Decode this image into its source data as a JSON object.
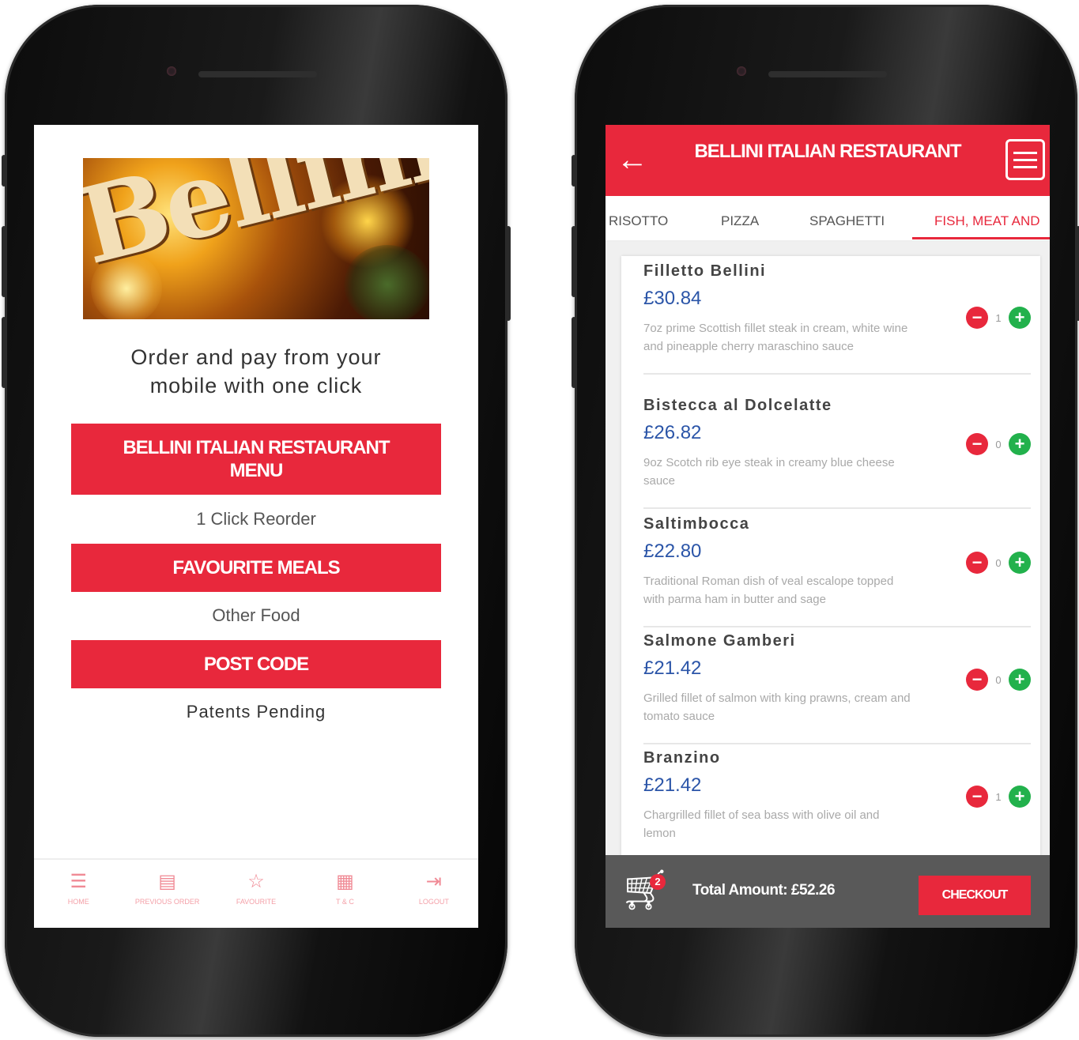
{
  "left": {
    "banner_logo": "Bellini",
    "tagline_line1": "Order and pay from your",
    "tagline_line2": "mobile with one click",
    "menu_button": "BELLINI ITALIAN RESTAURANT MENU",
    "reorder_text": "1 Click Reorder",
    "favourite_button": "FAVOURITE MEALS",
    "other_food_text": "Other Food",
    "postcode_button": "POST CODE",
    "patents_text": "Patents Pending",
    "nav": [
      {
        "icon": "list-icon",
        "label": "HOME"
      },
      {
        "icon": "receipt-icon",
        "label": "PREVIOUS ORDER"
      },
      {
        "icon": "star-icon",
        "label": "FAVOURITE"
      },
      {
        "icon": "calendar-icon",
        "label": "T & C"
      },
      {
        "icon": "logout-icon",
        "label": "LOGOUT"
      }
    ]
  },
  "right": {
    "title": "BELLINI ITALIAN RESTAURANT",
    "tabs": [
      "RISOTTO",
      "PIZZA",
      "SPAGHETTI",
      "FISH, MEAT AND"
    ],
    "active_tab": "FISH, MEAT AND",
    "items": [
      {
        "name": "Filletto Bellini",
        "price": "£30.84",
        "description": "7oz prime Scottish fillet steak in cream, white wine and pineapple cherry maraschino sauce",
        "qty": "1"
      },
      {
        "name": "Bistecca al Dolcelatte",
        "price": "£26.82",
        "description": "9oz Scotch rib eye steak in creamy blue cheese sauce",
        "qty": "0"
      },
      {
        "name": "Saltimbocca",
        "price": "£22.80",
        "description": "Traditional Roman dish of veal escalope topped with parma ham in butter and sage",
        "qty": "0"
      },
      {
        "name": "Salmone Gamberi",
        "price": "£21.42",
        "description": "Grilled fillet of salmon with king prawns, cream and tomato sauce",
        "qty": "0"
      },
      {
        "name": "Branzino",
        "price": "£21.42",
        "description": "Chargrilled fillet of sea bass with olive oil and lemon",
        "qty": "1"
      }
    ],
    "cart_count": "2",
    "total": "Total Amount: £52.26",
    "checkout": "CHECKOUT"
  },
  "colors": {
    "accent": "#e8283c",
    "price": "#2b55a8",
    "plus": "#22b14c",
    "cartbar": "#595959"
  }
}
